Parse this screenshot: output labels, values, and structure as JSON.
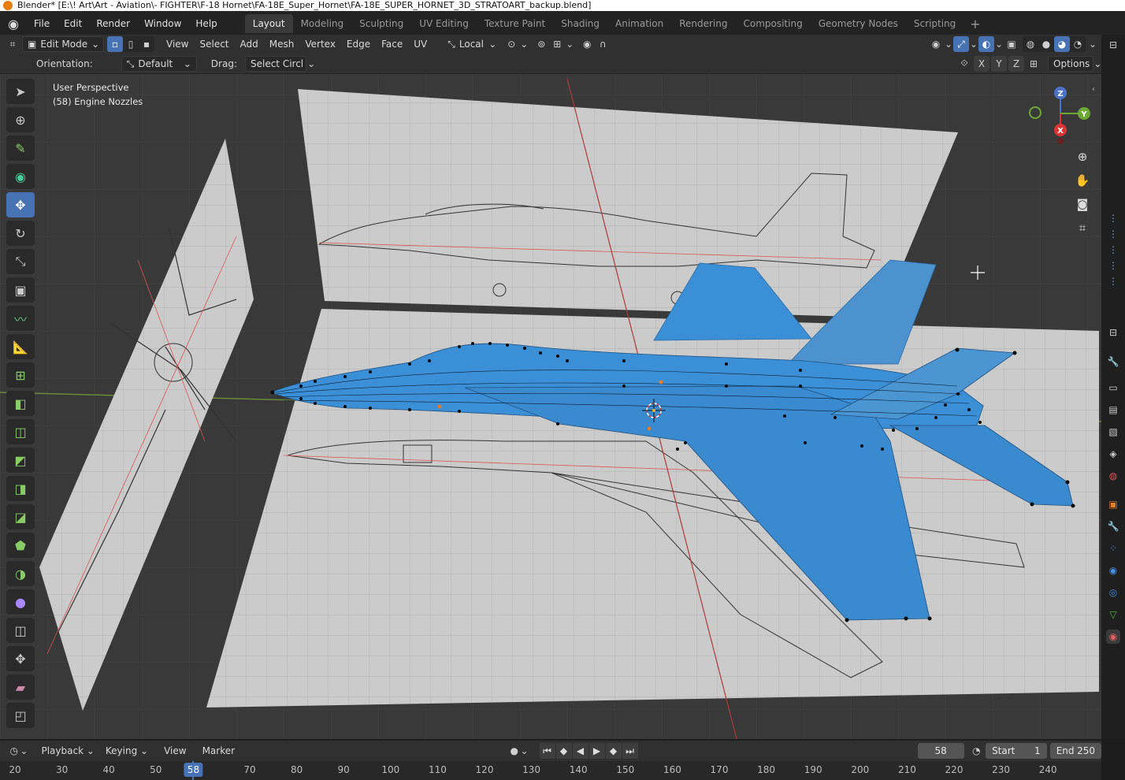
{
  "window": {
    "title": "Blender* [E:\\! Art\\Art - Aviation\\- FIGHTER\\F-18 Hornet\\FA-18E_Super_Hornet\\FA-18E_SUPER_HORNET_3D_STRATOART_backup.blend]"
  },
  "menu": [
    "File",
    "Edit",
    "Render",
    "Window",
    "Help"
  ],
  "workspaces": [
    "Layout",
    "Modeling",
    "Sculpting",
    "UV Editing",
    "Texture Paint",
    "Shading",
    "Animation",
    "Rendering",
    "Compositing",
    "Geometry Nodes",
    "Scripting"
  ],
  "active_workspace": "Layout",
  "header": {
    "mode": "Edit Mode",
    "menus": [
      "View",
      "Select",
      "Add",
      "Mesh",
      "Vertex",
      "Edge",
      "Face",
      "UV"
    ],
    "transform_space": "Local",
    "axes": [
      "X",
      "Y",
      "Z"
    ],
    "options": "Options"
  },
  "tool_settings": {
    "orientation_label": "Orientation:",
    "orientation_value": "Default",
    "drag_label": "Drag:",
    "drag_value": "Select Circl"
  },
  "viewport": {
    "view_name": "User Perspective",
    "object_info": "(58) Engine Nozzles",
    "gizmo_axes": {
      "z": "Z",
      "y": "Y",
      "x": "X"
    }
  },
  "toolbar_tools": [
    "tweak-select",
    "cursor",
    "annotate-active",
    "camera-active",
    "move",
    "rotate",
    "scale",
    "transform",
    "annotate",
    "measure",
    "add-cube",
    "extrude",
    "inset",
    "bevel",
    "loop-cut",
    "knife",
    "poly-build",
    "spin",
    "smooth",
    "edge-slide",
    "shrink-fatten",
    "shear",
    "rip"
  ],
  "timeline": {
    "menus": [
      "Playback",
      "Keying",
      "View",
      "Marker"
    ],
    "current_frame": "58",
    "start_label": "Start",
    "start_value": "1",
    "end_label": "End",
    "end_value": "250",
    "ruler": [
      "20",
      "30",
      "40",
      "50",
      "58",
      "70",
      "80",
      "90",
      "100",
      "110",
      "120",
      "130",
      "140",
      "150",
      "160",
      "170",
      "180",
      "190",
      "200",
      "210",
      "220",
      "230",
      "240"
    ]
  },
  "colors": {
    "accent": "#4772b3",
    "mesh": "#3b8fd6",
    "background": "#393939",
    "blueprint_sheet": "#c9c9c9"
  }
}
